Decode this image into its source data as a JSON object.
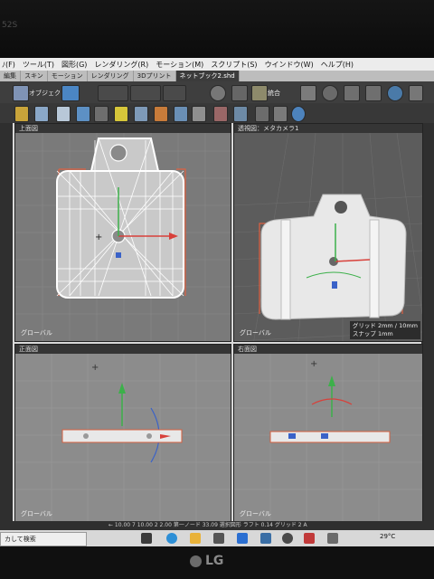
{
  "bezel": {
    "model": "52S",
    "brand": "LG"
  },
  "menu": [
    "ﾉ(F)",
    "ツール(T)",
    "図形(G)",
    "レンダリング(R)",
    "モーション(M)",
    "スクリプト(S)",
    "ウインドウ(W)",
    "ヘルプ(H)"
  ],
  "tabs": [
    "編集",
    "スキン",
    "モーション",
    "レンダリング",
    "3Dプリント",
    "ネットブック2.shd"
  ],
  "toolbar": {
    "object_label": "オブジェクト",
    "merge_label": "統合"
  },
  "viewports": {
    "top": {
      "title": "上面図",
      "footer": "グローバル"
    },
    "persp": {
      "title": "透視図：メタカメラ1",
      "footer": "グローバル",
      "grid": "グリッド 2mm / 10mm",
      "snap": "スナップ 1mm"
    },
    "front": {
      "title": "正面図",
      "footer": "グローバル"
    },
    "right": {
      "title": "右面図",
      "footer": "グローバル"
    }
  },
  "status": {
    "ruler": "← 10.00  7  10.00  2  2.00  第一ノード 33.09  選択図形  ラフト  0.14  グリッド  2  A",
    "search": "カして検索"
  },
  "tray": {
    "temp": "29°C"
  }
}
